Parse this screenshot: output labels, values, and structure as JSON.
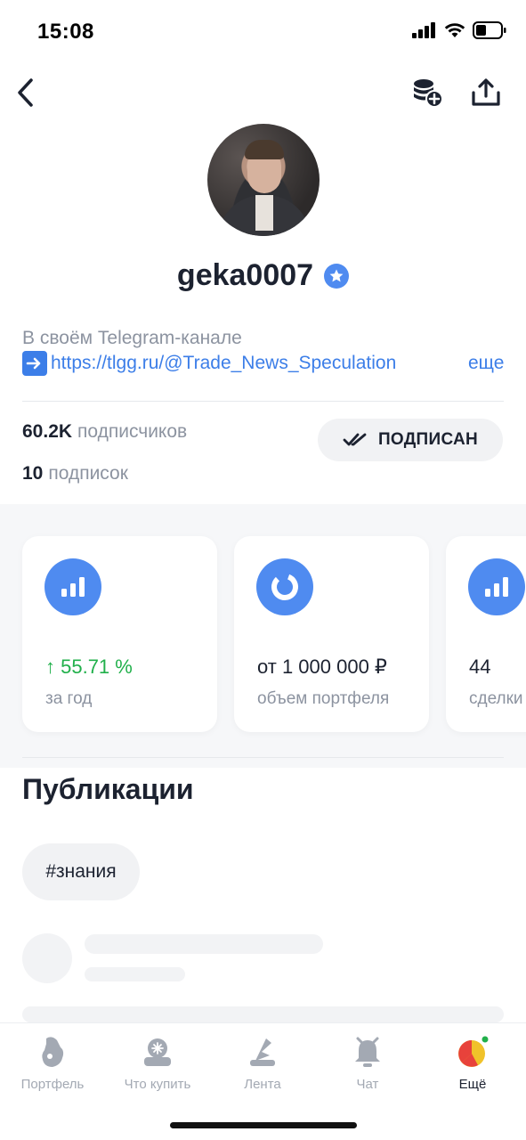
{
  "status_bar": {
    "time": "15:08"
  },
  "profile": {
    "username": "geka0007",
    "bio_line1": "В своём Telegram-канале",
    "bio_link": "https://tlgg.ru/@Trade_News_Speculation",
    "bio_more": "еще",
    "followers_count": "60.2K",
    "followers_label": "подписчиков",
    "following_count": "10",
    "following_label": "подписок",
    "subscribe_button": "ПОДПИСАН"
  },
  "cards": [
    {
      "value": "↑ 55.71 %",
      "caption": "за год",
      "icon": "bar-chart-icon"
    },
    {
      "value": "от 1 000 000 ₽",
      "caption": "объем портфеля",
      "icon": "donut-chart-icon"
    },
    {
      "value": "44",
      "caption": "сделки",
      "icon": "bar-chart-icon"
    }
  ],
  "publications": {
    "title": "Публикации",
    "tag": "#знания"
  },
  "tab_bar": {
    "items": [
      {
        "label": "Портфель",
        "icon": "portfolio-icon"
      },
      {
        "label": "Что купить",
        "icon": "what-to-buy-icon"
      },
      {
        "label": "Лента",
        "icon": "feed-icon"
      },
      {
        "label": "Чат",
        "icon": "chat-bell-icon"
      },
      {
        "label": "Ещё",
        "icon": "more-icon"
      }
    ],
    "active_index": 4
  },
  "colors": {
    "accent": "#4f8bf0",
    "link": "#3c7ee8",
    "positive": "#21b04b",
    "text": "#1c2230",
    "secondary": "#8c93a0"
  }
}
